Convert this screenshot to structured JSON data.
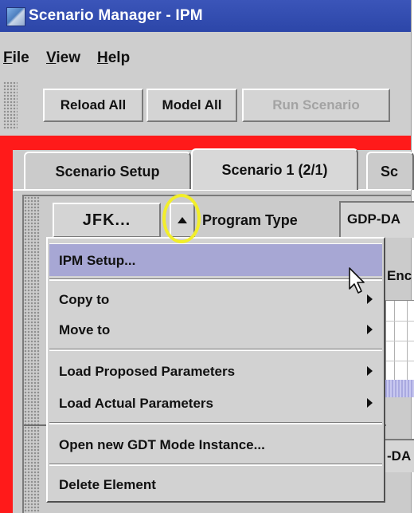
{
  "window": {
    "title": "Scenario Manager - IPM",
    "icon": "app-icon"
  },
  "menubar": {
    "items": [
      {
        "label": "File",
        "mnemonic": "F",
        "rest": "ile"
      },
      {
        "label": "View",
        "mnemonic": "V",
        "rest": "iew"
      },
      {
        "label": "Help",
        "mnemonic": "H",
        "rest": "elp"
      }
    ]
  },
  "toolbar": {
    "reload_all": "Reload All",
    "model_all": "Model All",
    "run_scenario": "Run Scenario"
  },
  "tabs": [
    {
      "label": "Scenario Setup",
      "active": false
    },
    {
      "label": "Scenario 1 (2/1)",
      "active": true
    },
    {
      "label": "Sc",
      "active": false
    }
  ],
  "content": {
    "airport_button": "JFK...",
    "dropdown_icon": "triangle-up-icon",
    "program_type_label": "Program Type",
    "program_type_value": "GDP-DA",
    "bg_label_1": "Enc",
    "bg_label_2": "-DA"
  },
  "popup_menu": {
    "items": [
      {
        "label": "IPM Setup...",
        "selected": true,
        "submenu": false
      },
      {
        "label": "Copy to",
        "selected": false,
        "submenu": true
      },
      {
        "label": "Move to",
        "selected": false,
        "submenu": true
      },
      {
        "label": "Load Proposed Parameters",
        "selected": false,
        "submenu": true
      },
      {
        "label": "Load Actual Parameters",
        "selected": false,
        "submenu": true
      },
      {
        "label": "Open new GDT Mode Instance...",
        "selected": false,
        "submenu": false
      },
      {
        "label": "Delete Element",
        "selected": false,
        "submenu": false
      }
    ]
  },
  "colors": {
    "titlebar": "#2c46a8",
    "frame_highlight": "#ff1a1a",
    "menu_selection": "#a7a7d4",
    "annotation_ring": "#f2ee2a"
  }
}
